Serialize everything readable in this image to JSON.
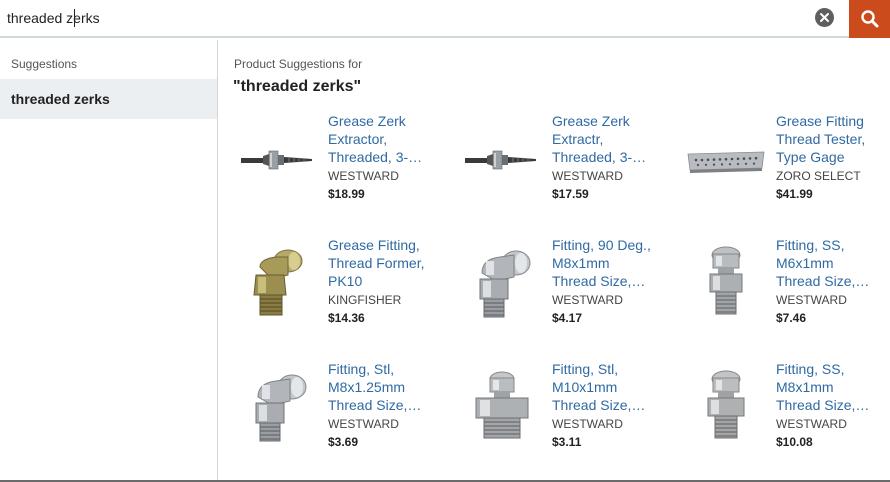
{
  "search": {
    "value": "threaded zerks",
    "clear_icon": "close-circle-icon",
    "search_icon": "magnifier-icon",
    "accent_color": "#cc4b1c"
  },
  "sidebar": {
    "heading": "Suggestions",
    "items": [
      {
        "label": "threaded zerks"
      }
    ]
  },
  "main": {
    "heading": "Product Suggestions for",
    "query": "\"threaded zerks\"",
    "products": [
      {
        "name_lines": [
          "Grease Zerk",
          "Extractor,",
          "Threaded, 3-…"
        ],
        "brand": "WESTWARD",
        "price": "$18.99",
        "icon": "zerk-extractor-tool"
      },
      {
        "name_lines": [
          "Grease Zerk",
          "Extractr,",
          "Threaded, 3-…"
        ],
        "brand": "WESTWARD",
        "price": "$17.59",
        "icon": "zerk-extractor-tool"
      },
      {
        "name_lines": [
          "Grease Fitting",
          "Thread Tester,",
          "Type Gage"
        ],
        "brand": "ZORO SELECT",
        "price": "$41.99",
        "icon": "thread-gage-plate"
      },
      {
        "name_lines": [
          "Grease Fitting,",
          "Thread Former,",
          "PK10"
        ],
        "brand": "KINGFISHER",
        "price": "$14.36",
        "icon": "angled-brass-fitting"
      },
      {
        "name_lines": [
          "Fitting, 90 Deg.,",
          "M8x1mm",
          "Thread Size,…"
        ],
        "brand": "WESTWARD",
        "price": "$4.17",
        "icon": "angled-steel-fitting"
      },
      {
        "name_lines": [
          "Fitting, SS,",
          "M6x1mm",
          "Thread Size,…"
        ],
        "brand": "WESTWARD",
        "price": "$7.46",
        "icon": "straight-ss-fitting"
      },
      {
        "name_lines": [
          "Fitting, Stl,",
          "M8x1.25mm",
          "Thread Size,…"
        ],
        "brand": "WESTWARD",
        "price": "$3.69",
        "icon": "angled-steel-fitting"
      },
      {
        "name_lines": [
          "Fitting, Stl,",
          "M10x1mm",
          "Thread Size,…"
        ],
        "brand": "WESTWARD",
        "price": "$3.11",
        "icon": "straight-steel-fitting-wide"
      },
      {
        "name_lines": [
          "Fitting, SS,",
          "M8x1mm",
          "Thread Size,…"
        ],
        "brand": "WESTWARD",
        "price": "$10.08",
        "icon": "straight-ss-fitting"
      }
    ]
  }
}
